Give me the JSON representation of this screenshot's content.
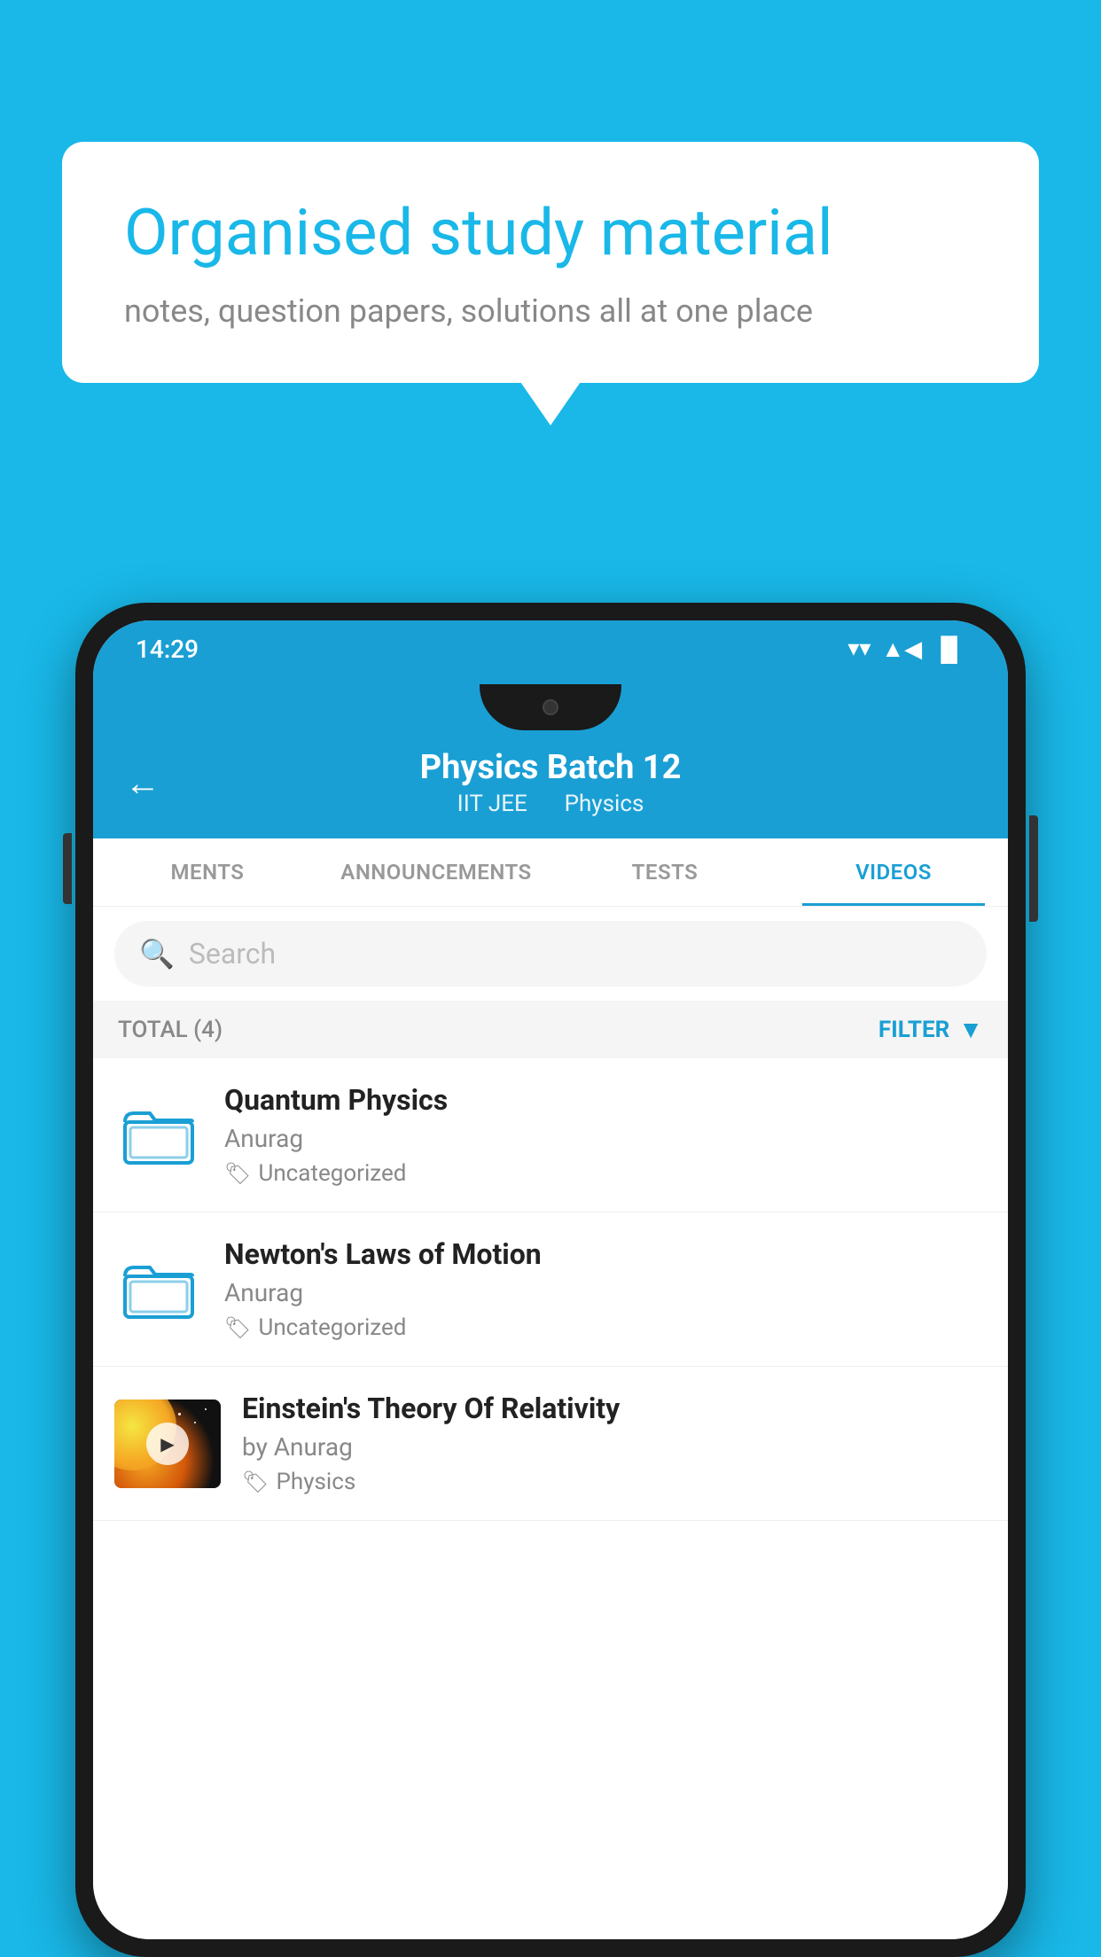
{
  "background_color": "#19b8e8",
  "speech_bubble": {
    "title": "Organised study material",
    "subtitle": "notes, question papers, solutions all at one place"
  },
  "phone": {
    "status_bar": {
      "time": "14:29",
      "wifi": "▼",
      "signal": "▲",
      "battery": "▐"
    },
    "header": {
      "back_label": "←",
      "title": "Physics Batch 12",
      "subtitle_part1": "IIT JEE",
      "subtitle_part2": "Physics"
    },
    "tabs": [
      {
        "label": "MENTS",
        "active": false
      },
      {
        "label": "ANNOUNCEMENTS",
        "active": false
      },
      {
        "label": "TESTS",
        "active": false
      },
      {
        "label": "VIDEOS",
        "active": true
      }
    ],
    "search": {
      "placeholder": "Search"
    },
    "filter_bar": {
      "total_label": "TOTAL (4)",
      "filter_label": "FILTER"
    },
    "videos": [
      {
        "title": "Quantum Physics",
        "author": "Anurag",
        "tag": "Uncategorized",
        "has_thumbnail": false
      },
      {
        "title": "Newton's Laws of Motion",
        "author": "Anurag",
        "tag": "Uncategorized",
        "has_thumbnail": false
      },
      {
        "title": "Einstein's Theory Of Relativity",
        "author": "by Anurag",
        "tag": "Physics",
        "has_thumbnail": true
      }
    ]
  }
}
